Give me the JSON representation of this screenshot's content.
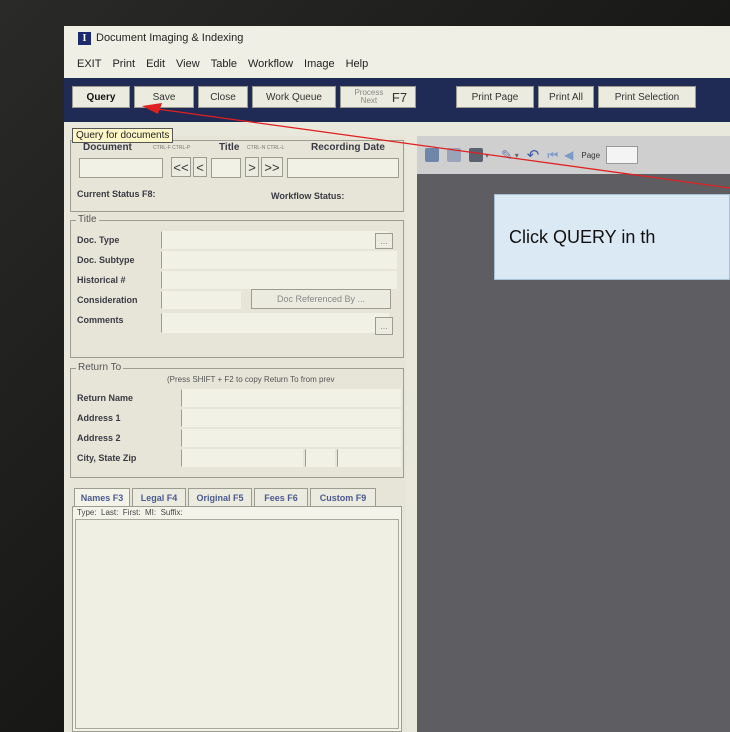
{
  "window": {
    "title": "Document Imaging & Indexing",
    "icon_letter": "I"
  },
  "menu": [
    "EXIT",
    "Print",
    "Edit",
    "View",
    "Table",
    "Workflow",
    "Image",
    "Help"
  ],
  "toolbar": {
    "buttons": [
      {
        "label": "Query"
      },
      {
        "label": "Save"
      },
      {
        "label": "Close"
      },
      {
        "label": "Work Queue"
      },
      {
        "label": "Process Next",
        "key": "F7"
      },
      {
        "label": "Print Page"
      },
      {
        "label": "Print All"
      },
      {
        "label": "Print Selection"
      }
    ]
  },
  "tooltip": "Query for documents",
  "document": {
    "label": "Document",
    "shortcut_prev": "CTRL-F CTRL-P",
    "title_label": "Title",
    "shortcut_next": "CTRL-N CTRL-L",
    "recording_date_label": "Recording Date",
    "nav": {
      "first": "<<",
      "prev": "<",
      "next": ">",
      "last": ">>"
    },
    "current_status_label": "Current Status F8:",
    "workflow_status_label": "Workflow Status:"
  },
  "title_section": {
    "legend": "Title",
    "doc_type": "Doc. Type",
    "doc_subtype": "Doc. Subtype",
    "historical": "Historical #",
    "consideration": "Consideration",
    "comments": "Comments",
    "doc_referenced_by": "Doc Referenced By ...",
    "ellipsis": "..."
  },
  "return_to": {
    "legend": "Return To",
    "hint": "(Press SHIFT + F2 to copy Return To from prev",
    "return_name": "Return Name",
    "address1": "Address 1",
    "address2": "Address 2",
    "city_state_zip": "City, State Zip"
  },
  "tabs": [
    "Names F3",
    "Legal F4",
    "Original F5",
    "Fees F6",
    "Custom F9"
  ],
  "names_header": "Type:  Last:  First:  MI:  Suffix:",
  "viewer": {
    "page_label": "Page"
  },
  "callout": {
    "text": "Click QUERY in th"
  },
  "colors": {
    "toolbar": "#1f2a55",
    "arrow": "#e02020",
    "callout_bg": "#dbe9f5",
    "viewer_bg": "#5e5e62"
  }
}
